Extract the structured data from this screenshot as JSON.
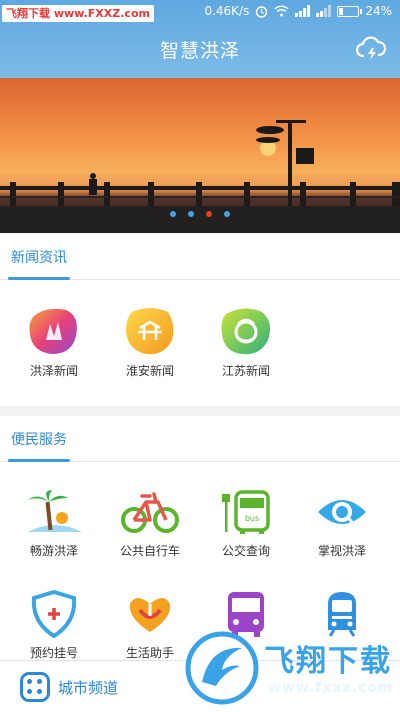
{
  "status": {
    "watermark": "飞翔下载 www.FXXZ.com",
    "speed": "0.46K/s",
    "battery": "24%",
    "battery_level": 0.24
  },
  "header": {
    "title": "智慧洪泽",
    "weather_icon": "cloud-lightning-icon"
  },
  "banner": {
    "slide_count": 4,
    "active_index": 2
  },
  "news": {
    "title": "新闻资讯",
    "items": [
      {
        "label": "洪泽新闻",
        "icon": "hongze-news-icon"
      },
      {
        "label": "淮安新闻",
        "icon": "huaian-news-icon"
      },
      {
        "label": "江苏新闻",
        "icon": "jiangsu-news-icon"
      }
    ]
  },
  "services": {
    "title": "便民服务",
    "items": [
      {
        "label": "畅游洪泽",
        "icon": "palm-tree-icon"
      },
      {
        "label": "公共自行车",
        "icon": "bicycle-icon"
      },
      {
        "label": "公交查询",
        "icon": "bus-stop-icon"
      },
      {
        "label": "掌视洪泽",
        "icon": "eye-icon"
      },
      {
        "label": "预约挂号",
        "icon": "medical-shield-icon"
      },
      {
        "label": "生活助手",
        "icon": "heart-hands-icon"
      },
      {
        "label": "",
        "icon": "purple-bus-icon"
      },
      {
        "label": "",
        "icon": "train-icon"
      }
    ]
  },
  "bottom": {
    "label": "城市频道",
    "icon": "city-grid-icon"
  },
  "overlay_watermark": {
    "text": "飞翔下载",
    "url": "www.fxxz.com"
  }
}
